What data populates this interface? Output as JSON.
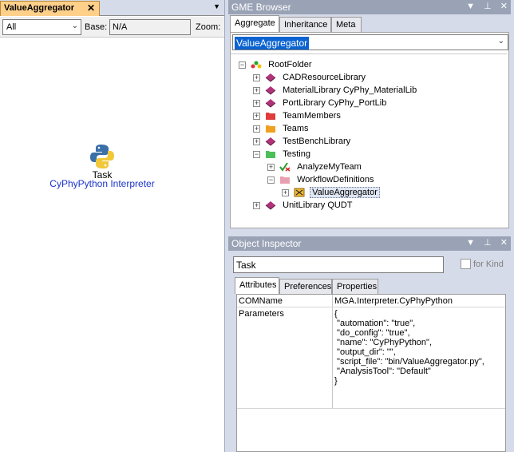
{
  "editor": {
    "tab_label": "ValueAggregator",
    "tab_close": "✕",
    "tab_menu_arrow": "▼",
    "aspect_value": "All",
    "base_label": "Base:",
    "base_value": "N/A",
    "zoom_label": "Zoom:",
    "node": {
      "icon": "python-logo-icon",
      "name": "Task",
      "type": "CyPhyPython Interpreter"
    }
  },
  "browser": {
    "title": "GME Browser",
    "btn_menu": "▼",
    "btn_pin": "📌",
    "btn_close": "✕",
    "tabs": [
      "Aggregate",
      "Inheritance",
      "Meta"
    ],
    "active_tab": "Aggregate",
    "combo_value": "ValueAggregator",
    "tree": [
      {
        "label": "RootFolder",
        "expander": "⊟",
        "icon": "root-folder-icon"
      },
      {
        "label": "CADResourceLibrary",
        "expander": "⊞",
        "icon": "library-icon"
      },
      {
        "label": "MaterialLibrary CyPhy_MaterialLib",
        "expander": "⊞",
        "icon": "library-icon"
      },
      {
        "label": "PortLibrary CyPhy_PortLib",
        "expander": "⊞",
        "icon": "library-icon"
      },
      {
        "label": "TeamMembers",
        "expander": "⊞",
        "icon": "red-folder-icon"
      },
      {
        "label": "Teams",
        "expander": "⊞",
        "icon": "orange-folder-icon"
      },
      {
        "label": "TestBenchLibrary",
        "expander": "⊞",
        "icon": "library-icon"
      },
      {
        "label": "Testing",
        "expander": "⊟",
        "icon": "green-folder-icon"
      },
      {
        "label": "AnalyzeMyTeam",
        "expander": "⊞",
        "icon": "check-model-icon"
      },
      {
        "label": "WorkflowDefinitions",
        "expander": "⊟",
        "icon": "pink-folder-icon"
      },
      {
        "label": "ValueAggregator",
        "expander": "⊞",
        "icon": "workflow-model-icon"
      },
      {
        "label": "UnitLibrary QUDT",
        "expander": "⊞",
        "icon": "library-icon"
      }
    ]
  },
  "inspector": {
    "title": "Object Inspector",
    "btn_menu": "▼",
    "btn_pin": "📌",
    "btn_close": "✕",
    "name_value": "Task",
    "for_kind_label": "for Kind",
    "tabs": [
      "Attributes",
      "Preferences",
      "Properties"
    ],
    "active_tab": "Attributes",
    "attributes": {
      "comname_key": "COMName",
      "comname_value": "MGA.Interpreter.CyPhyPython",
      "parameters_key": "Parameters",
      "parameters_lines": [
        "{",
        " \"automation\": \"true\",",
        " \"do_config\": \"true\",",
        " \"name\": \"CyPhyPython\",",
        " \"output_dir\": \"\",",
        " \"script_file\": \"bin/ValueAggregator.py\",",
        " \"AnalysisTool\": \"Default\"",
        "}"
      ]
    }
  },
  "colors": {
    "panel_title_bg": "#9aa3b6",
    "tab_active_bg": "#ffd08a",
    "selection_bg": "#0b63d1",
    "node_type_text": "#1a35c8"
  }
}
